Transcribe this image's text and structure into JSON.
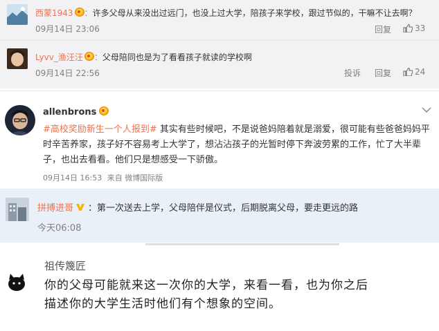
{
  "comments_top": [
    {
      "username": "西蒙1943",
      "separator": "：",
      "text": "许多父母从来没出过远门，也没上过大学，陪孩子来学校，跟过节似的，干嘛不让去啊？",
      "timestamp": "09月14日 23:06",
      "reply_label": "回复",
      "like_count": "33"
    },
    {
      "username": "Lyvv_渔汪汪",
      "separator": "：",
      "text": "父母陪同也是为了看看孩子就读的学校啊",
      "timestamp": "09月14日 22:56",
      "report_label": "投诉",
      "reply_label": "回复",
      "like_count": "24"
    }
  ],
  "post": {
    "username": "allenbrons",
    "topic": "#高校奖励新生一个人报到#",
    "text": " 其实有些时候吧，不是说爸妈陪着就是溺爱，很可能有些爸爸妈妈平时辛苦养家，孩子好不容易考上大学了，想沾沾孩子的光暂时停下奔波劳累的工作，忙了大半辈子，也出去看看。他们只是想感受一下骄傲。",
    "timestamp": "09月14日 16:53",
    "source": "来自 微博国际版"
  },
  "reply": {
    "username": "拼搏进哥",
    "separator": "：",
    "text": "第一次送去上学，父母陪伴是仪式，后期脱离父母，要走更远的路",
    "timestamp": "今天06:08"
  },
  "quote": {
    "username": "祖传篾匠",
    "text": "你的父母可能就来这一次你的大学，来看一看，也为你之后描述你的大学生活时他们有个想象的空间。"
  },
  "colors": {
    "username_orange": "#eb7350",
    "meta_gray": "#808080",
    "panel1_bg": "#f2f2f5",
    "panel3_bg": "#eaf0f8"
  },
  "icons": [
    "crown-badge-icon",
    "thumb-up-icon",
    "chevron-down-icon",
    "verified-v-icon"
  ]
}
